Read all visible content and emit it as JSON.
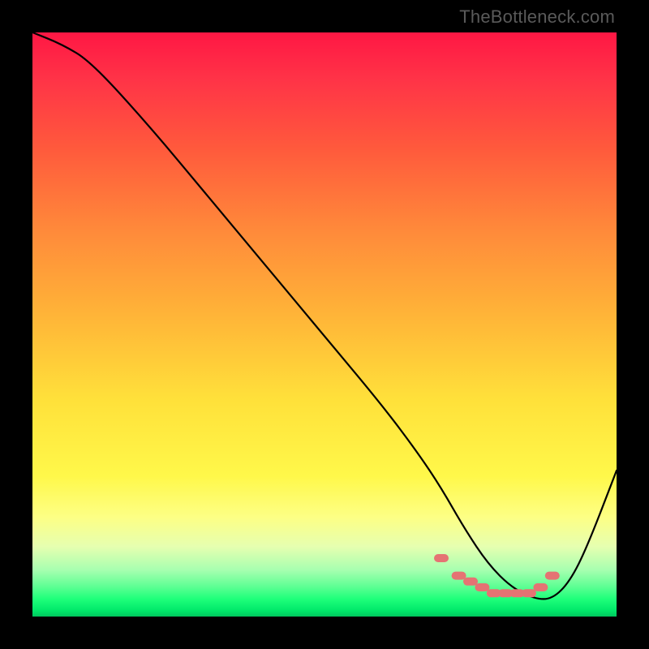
{
  "watermark": "TheBottleneck.com",
  "chart_data": {
    "type": "line",
    "title": "",
    "xlabel": "",
    "ylabel": "",
    "xlim": [
      0,
      100
    ],
    "ylim": [
      0,
      100
    ],
    "grid": false,
    "legend": false,
    "series": [
      {
        "name": "curve",
        "color": "#000000",
        "x": [
          0,
          5,
          10,
          20,
          30,
          40,
          50,
          60,
          66,
          70,
          74,
          78,
          82,
          86,
          89,
          92,
          95,
          100
        ],
        "y": [
          100,
          98,
          95,
          84,
          72,
          60,
          48,
          36,
          28,
          22,
          15,
          9,
          5,
          3,
          3,
          6,
          12,
          25
        ]
      }
    ],
    "beads": {
      "color": "#e57373",
      "x": [
        70,
        73,
        75,
        77,
        79,
        81,
        83,
        85,
        87,
        89
      ],
      "y": [
        10,
        7,
        6,
        5,
        4,
        4,
        4,
        4,
        5,
        7
      ]
    },
    "gradient_stops": [
      {
        "pos": 0.0,
        "color": "#ff1744"
      },
      {
        "pos": 0.5,
        "color": "#ffd23a"
      },
      {
        "pos": 0.8,
        "color": "#fcff5a"
      },
      {
        "pos": 0.95,
        "color": "#6fff95"
      },
      {
        "pos": 1.0,
        "color": "#00c85e"
      }
    ]
  }
}
